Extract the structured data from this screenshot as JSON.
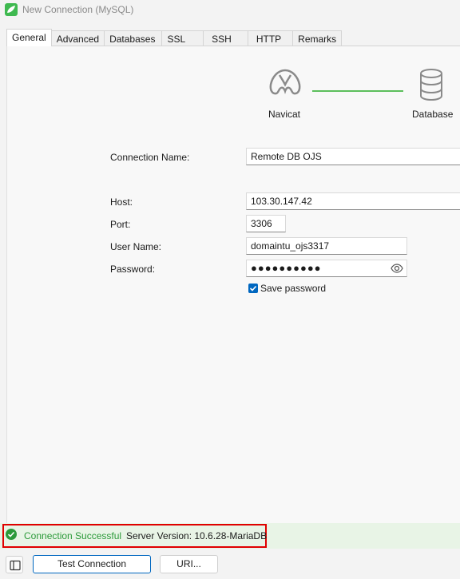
{
  "window": {
    "title": "New Connection (MySQL)"
  },
  "tabs": [
    "General",
    "Advanced",
    "Databases",
    "SSL",
    "SSH",
    "HTTP",
    "Remarks"
  ],
  "illustration": {
    "left_caption": "Navicat",
    "right_caption": "Database",
    "left_icon": "navicat-logo-icon",
    "right_icon": "database-icon",
    "line_color": "#5cbf5c"
  },
  "form": {
    "connection_name_label": "Connection Name:",
    "connection_name_value": "Remote DB OJS",
    "host_label": "Host:",
    "host_value": "103.30.147.42",
    "port_label": "Port:",
    "port_value": "3306",
    "user_label": "User Name:",
    "user_value": "domaintu_ojs3317",
    "password_label": "Password:",
    "password_value": "●●●●●●●●●●",
    "save_password_label": "Save password",
    "save_password_checked": true
  },
  "status": {
    "message": "Connection Successful",
    "version": "Server Version: 10.6.28-MariaDB",
    "success_color": "#2c9a3a",
    "highlight_color": "#e00000"
  },
  "buttons": {
    "test_connection": "Test Connection",
    "uri": "URI..."
  },
  "colors": {
    "accent": "#0067c0",
    "app_icon": "#3fb950"
  }
}
